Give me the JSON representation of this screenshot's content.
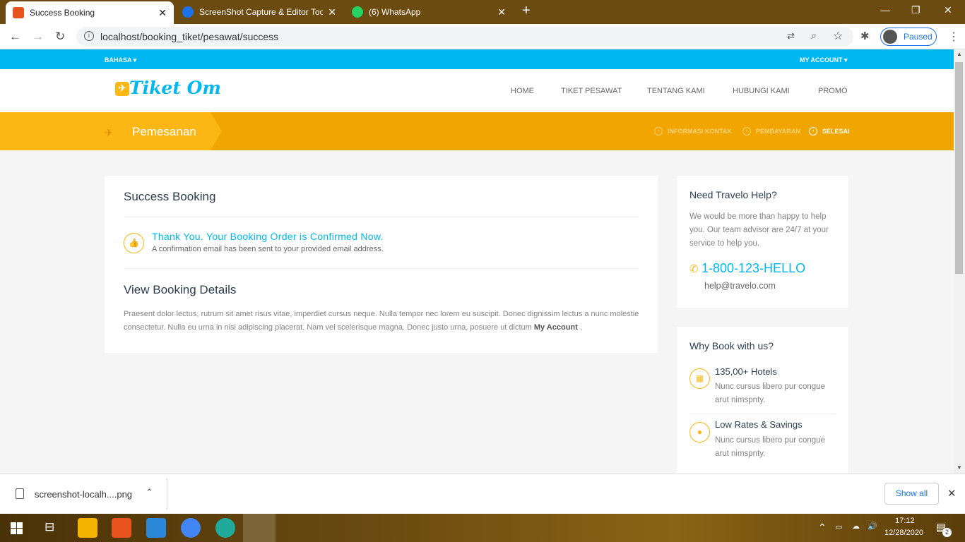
{
  "browser": {
    "tabs": [
      {
        "title": "Success Booking",
        "active": true
      },
      {
        "title": "ScreenShot Capture & Editor Too",
        "active": false
      },
      {
        "title": "(6) WhatsApp",
        "active": false
      }
    ],
    "new_tab_label": "+",
    "url": "localhost/booking_tiket/pesawat/success",
    "profile_status": "Paused"
  },
  "site": {
    "topbar": {
      "language": "BAHASA ▾",
      "account": "MY ACCOUNT ▾"
    },
    "logo": "Tiket Om",
    "menu": [
      "HOME",
      "TIKET PESAWAT",
      "TENTANG KAMI",
      "HUBUNGI KAMI",
      "PROMO"
    ],
    "banner_title": "Pemesanan",
    "steps": [
      {
        "label": "INFORMASI KONTAK",
        "current": false
      },
      {
        "label": "PEMBAYARAN",
        "current": false
      },
      {
        "label": "SELESAI",
        "current": true
      }
    ]
  },
  "main": {
    "title": "Success Booking",
    "confirm_heading": "Thank You. Your Booking Order is Confirmed Now.",
    "confirm_sub": "A confirmation email has been sent to your provided email address.",
    "details_title": "View Booking Details",
    "details_text": "Praesent dolor lectus, rutrum sit amet risus vitae, imperdiet cursus neque. Nulla tempor nec lorem eu suscipit. Donec dignissim lectus a nunc molestie consectetur. Nulla eu urna in nisi adipiscing placerat. Nam vel scelerisque magna. Donec justo urna, posuere ut dictum",
    "details_link": "My Account",
    "details_end": "."
  },
  "sidebar": {
    "help_title": "Need Travelo Help?",
    "help_text": "We would be more than happy to help you. Our team advisor are 24/7 at your service to help you.",
    "phone": "1-800-123-HELLO",
    "email": "help@travelo.com",
    "why_title": "Why Book with us?",
    "features": [
      {
        "title": "135,00+ Hotels",
        "text": "Nunc cursus libero pur congue arut nimspnty."
      },
      {
        "title": "Low Rates & Savings",
        "text": "Nunc cursus libero pur congue arut nimspnty."
      }
    ]
  },
  "downloads": {
    "file": "screenshot-localh....png",
    "show_all": "Show all"
  },
  "taskbar": {
    "time": "17:12",
    "date": "12/28/2020",
    "notifications": "2"
  },
  "colors": {
    "accent_blue": "#01b7f2",
    "accent_yellow": "#fdb714",
    "banner_yellow": "#f0a500"
  }
}
